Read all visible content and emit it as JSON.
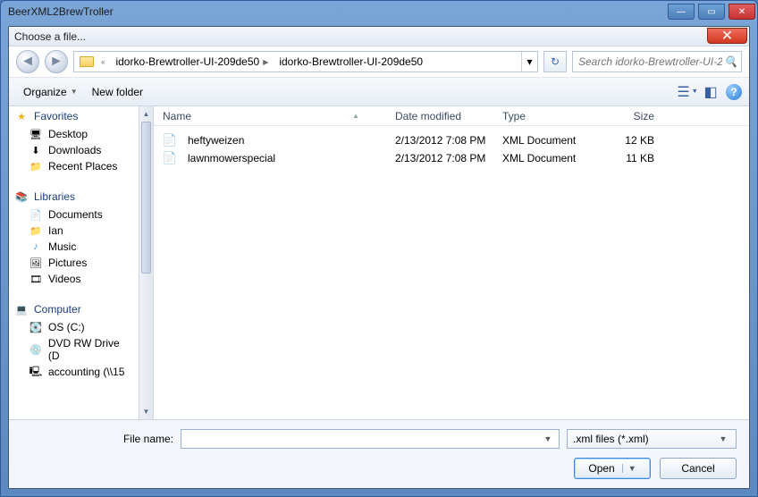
{
  "outer_window": {
    "title": "BeerXML2BrewTroller"
  },
  "dialog": {
    "title": "Choose a file...",
    "breadcrumb": {
      "segments": [
        "idorko-Brewtroller-UI-209de50",
        "idorko-Brewtroller-UI-209de50"
      ]
    },
    "search_placeholder": "Search idorko-Brewtroller-UI-2...",
    "toolbar": {
      "organize": "Organize",
      "new_folder": "New folder"
    },
    "tree": {
      "favorites_label": "Favorites",
      "favorites": [
        {
          "label": "Desktop",
          "icon": "desktop"
        },
        {
          "label": "Downloads",
          "icon": "downloads"
        },
        {
          "label": "Recent Places",
          "icon": "recent"
        }
      ],
      "libraries_label": "Libraries",
      "libraries": [
        {
          "label": "Documents"
        },
        {
          "label": "Ian"
        },
        {
          "label": "Music"
        },
        {
          "label": "Pictures"
        },
        {
          "label": "Videos"
        }
      ],
      "computer_label": "Computer",
      "computer": [
        {
          "label": "OS (C:)"
        },
        {
          "label": "DVD RW Drive (D"
        },
        {
          "label": "accounting (\\\\15"
        }
      ]
    },
    "columns": {
      "name": "Name",
      "date": "Date modified",
      "type": "Type",
      "size": "Size"
    },
    "files": [
      {
        "name": "heftyweizen",
        "date": "2/13/2012 7:08 PM",
        "type": "XML Document",
        "size": "12 KB"
      },
      {
        "name": "lawnmowerspecial",
        "date": "2/13/2012 7:08 PM",
        "type": "XML Document",
        "size": "11 KB"
      }
    ],
    "footer": {
      "file_name_label": "File name:",
      "file_name_value": "",
      "filter": ".xml files (*.xml)",
      "open": "Open",
      "cancel": "Cancel"
    }
  }
}
